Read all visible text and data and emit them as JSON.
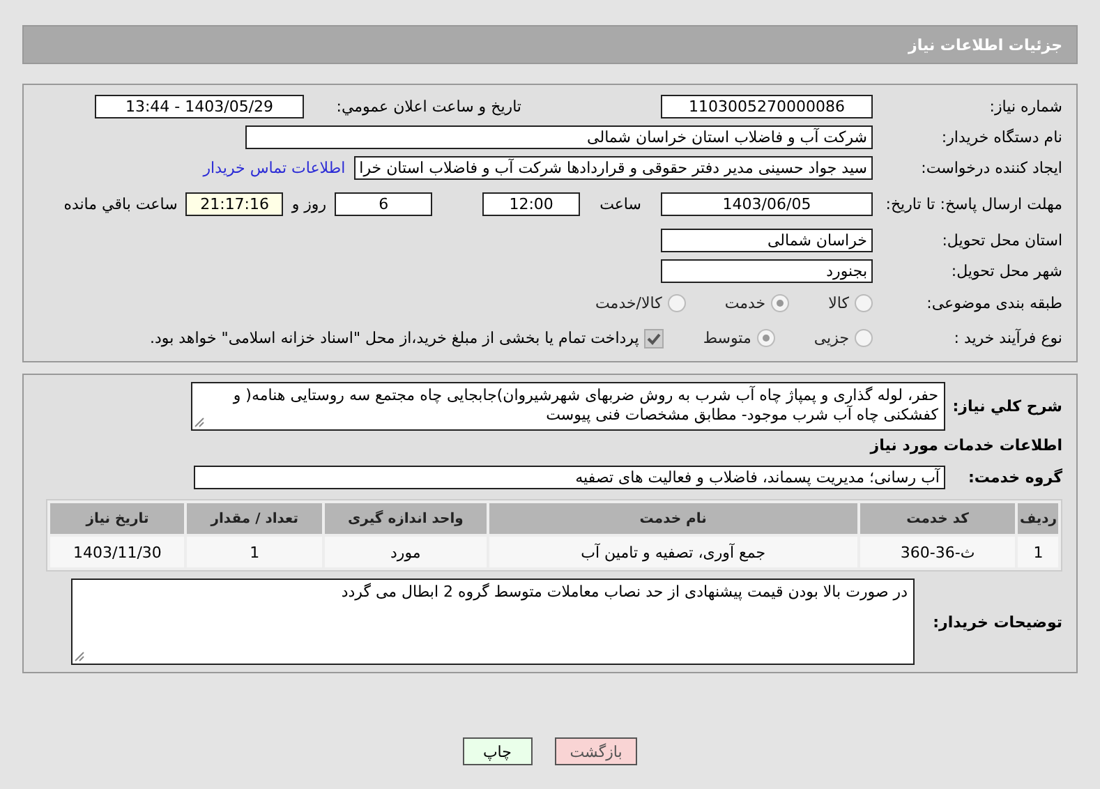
{
  "header": {
    "title": "جزئیات اطلاعات نیاز"
  },
  "need_number": {
    "label": "شماره نیاز:",
    "value": "1103005270000086"
  },
  "announce": {
    "label": "تاریخ و ساعت اعلان عمومي:",
    "value": "1403/05/29 - 13:44"
  },
  "buyer": {
    "label": "نام دستگاه خریدار:",
    "value": "شرکت آب و فاضلاب استان خراسان شمالی"
  },
  "creator": {
    "label": "ایجاد کننده درخواست:",
    "value": "سید جواد حسینی مدیر دفتر حقوقی و قراردادها  شرکت آب و فاضلاب استان خرا",
    "link": "اطلاعات تماس خریدار"
  },
  "deadline": {
    "label": "مهلت ارسال پاسخ: تا تاریخ:",
    "date": "1403/06/05",
    "time_label": "ساعت",
    "time": "12:00",
    "days": "6",
    "days_label": "روز و",
    "remaining": "21:17:16",
    "remaining_label": "ساعت باقي مانده"
  },
  "province": {
    "label": "استان محل تحویل:",
    "value": "خراسان شمالی"
  },
  "city": {
    "label": "شهر محل تحویل:",
    "value": "بجنورد"
  },
  "category": {
    "label": "طبقه بندی موضوعی:",
    "options": [
      {
        "label": "کالا",
        "selected": false
      },
      {
        "label": "خدمت",
        "selected": true
      },
      {
        "label": "کالا/خدمت",
        "selected": false
      }
    ]
  },
  "process": {
    "label": "نوع فرآیند خرید :",
    "options": [
      {
        "label": "جزیی",
        "selected": false
      },
      {
        "label": "متوسط",
        "selected": true
      }
    ],
    "treasury": {
      "label": "پرداخت تمام یا بخشی از مبلغ خرید،از محل \"اسناد خزانه اسلامی\" خواهد بود.",
      "checked": true
    }
  },
  "description": {
    "label": "شرح کلي نیاز:",
    "value": "حفر، لوله گذاری و پمپاژ چاه آب شرب به روش ضربهای شهرشیروان)جابجایی چاه مجتمع سه روستایی هنامه( و کفشکنی چاه آب شرب موجود- مطابق مشخصات فنی پیوست"
  },
  "services": {
    "title": "اطلاعات خدمات مورد نیاز",
    "group_label": "گروه خدمت:",
    "group": "آب رسانی؛ مدیریت پسماند، فاضلاب و فعالیت های تصفیه",
    "table": {
      "columns": [
        "ردیف",
        "کد خدمت",
        "نام خدمت",
        "واحد اندازه گیری",
        "تعداد / مقدار",
        "تاریخ نیاز"
      ],
      "rows": [
        [
          "1",
          "ث-36-360",
          "جمع آوری، تصفیه و تامین آب",
          "مورد",
          "1",
          "1403/11/30"
        ]
      ]
    }
  },
  "buyer_notes": {
    "label": "توضیحات خریدار:",
    "value": "در صورت  بالا بودن قیمت پیشنهادی از حد نصاب معاملات متوسط گروه 2 ابطال می گردد"
  },
  "buttons": [
    {
      "label": "بازگشت",
      "kind": "back"
    },
    {
      "label": "چاپ",
      "kind": "print"
    }
  ]
}
